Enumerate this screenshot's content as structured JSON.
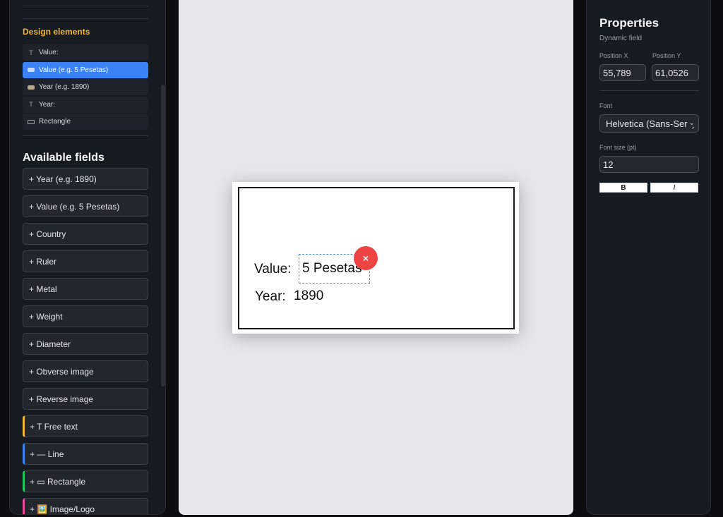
{
  "left_panel": {
    "design_elements_title": "Design elements",
    "design_elements": [
      {
        "icon": "text-icon",
        "glyph": "T",
        "label": "Value:",
        "selected": false
      },
      {
        "icon": "dynamic-field-icon",
        "glyph": "",
        "label": "Value (e.g. 5 Pesetas)",
        "selected": true
      },
      {
        "icon": "dynamic-field-icon",
        "glyph": "",
        "label": "Year (e.g. 1890)",
        "selected": false
      },
      {
        "icon": "text-icon",
        "glyph": "T",
        "label": "Year:",
        "selected": false
      },
      {
        "icon": "rectangle-icon",
        "glyph": "",
        "label": "Rectangle",
        "selected": false
      }
    ],
    "available_fields_title": "Available fields",
    "available_fields": [
      {
        "label": "+ Year (e.g. 1890)",
        "accent": null
      },
      {
        "label": "+ Value (e.g. 5 Pesetas)",
        "accent": null
      },
      {
        "label": "+ Country",
        "accent": null
      },
      {
        "label": "+ Ruler",
        "accent": null
      },
      {
        "label": "+ Metal",
        "accent": null
      },
      {
        "label": "+ Weight",
        "accent": null
      },
      {
        "label": "+ Diameter",
        "accent": null
      },
      {
        "label": "+ Obverse image",
        "accent": null
      },
      {
        "label": "+ Reverse image",
        "accent": null
      },
      {
        "label": "+ T Free text",
        "accent": "#f2b632"
      },
      {
        "label": "+ — Line",
        "accent": "#3b82f6"
      },
      {
        "label": "+ ▭ Rectangle",
        "accent": "#22c55e"
      },
      {
        "label": "+ 🖼️ Image/Logo",
        "accent": "#ec4899"
      }
    ]
  },
  "canvas": {
    "value_label": "Value:",
    "value_field": "5 Pesetas",
    "year_label": "Year:",
    "year_value": "1890",
    "delete_glyph": "×"
  },
  "properties": {
    "title": "Properties",
    "subtitle": "Dynamic field",
    "position_x_label": "Position X",
    "position_x_value": "55,789",
    "position_y_label": "Position Y",
    "position_y_value": "61,0526",
    "font_label": "Font",
    "font_value": "Helvetica (Sans-Serif)",
    "font_size_label": "Font size (pt)",
    "font_size_value": "12",
    "bold_label": "B",
    "italic_label": "I"
  },
  "colors": {
    "accent_blue": "#3b82f6",
    "section_gold": "#f2b632",
    "delete_red": "#ef4444"
  }
}
